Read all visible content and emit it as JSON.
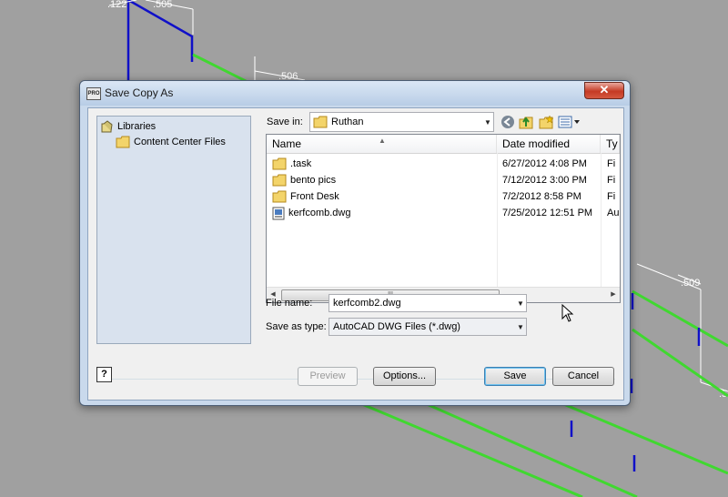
{
  "background": {
    "dimension_labels": [
      ".122",
      ".505",
      ".506",
      ".509",
      ".5"
    ]
  },
  "dialog": {
    "title": "Save Copy As",
    "app_icon_text": "PRO",
    "close_glyph": "✕"
  },
  "libraries": {
    "root_label": "Libraries",
    "child_label": "Content Center Files"
  },
  "save_in": {
    "label": "Save in:",
    "value": "Ruthan"
  },
  "toolbar_icons": [
    "back-icon",
    "up-folder-icon",
    "new-folder-icon",
    "views-menu-icon"
  ],
  "file_list": {
    "columns": [
      "Name",
      "Date modified",
      "Ty"
    ],
    "rows": [
      {
        "name": ".task",
        "date": "6/27/2012 4:08 PM",
        "type": "Fi",
        "icon": "folder-icon"
      },
      {
        "name": "bento pics",
        "date": "7/12/2012 3:00 PM",
        "type": "Fi",
        "icon": "folder-icon"
      },
      {
        "name": "Front Desk",
        "date": "7/2/2012 8:58 PM",
        "type": "Fi",
        "icon": "folder-icon"
      },
      {
        "name": "kerfcomb.dwg",
        "date": "7/25/2012 12:51 PM",
        "type": "Au",
        "icon": "dwg-file-icon"
      }
    ],
    "scroll_grip": "III"
  },
  "file_name": {
    "label": "File name:",
    "value": "kerfcomb2.dwg"
  },
  "save_as_type": {
    "label": "Save as type:",
    "value": "AutoCAD DWG Files (*.dwg)"
  },
  "buttons": {
    "help": "?",
    "preview": "Preview",
    "options": "Options...",
    "save": "Save",
    "cancel": "Cancel"
  },
  "colors": {
    "cad_background": "#a0a0a0",
    "cad_blue_line": "#1010c8",
    "cad_green_line": "#40d830",
    "dialog_frame": "#c9d9ec",
    "close_button": "#c53a24"
  }
}
